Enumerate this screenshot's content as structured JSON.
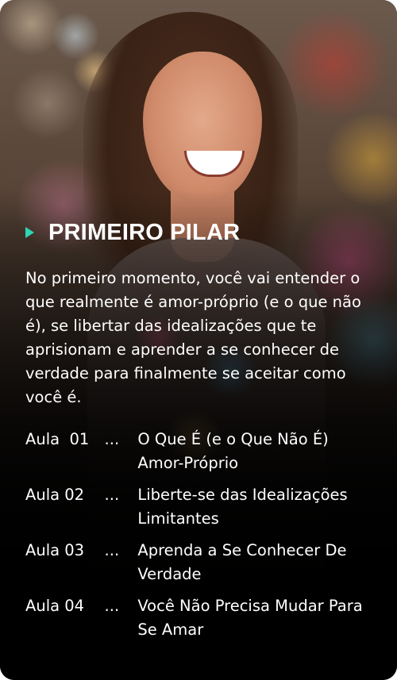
{
  "pillar": {
    "title": "PRIMEIRO PILAR",
    "description": "No primeiro momento, você vai entender o que realmente é amor-próprio (e o que não é), se libertar das idealizações que te aprisionam e aprender a se conhecer de verdade para finalmente se aceitar como você é.",
    "accent_color": "#2ed6b4",
    "icon": "play-triangle-icon"
  },
  "lessons": [
    {
      "label": "Aula  01",
      "separator": "...",
      "title": "O Que É (e o Que Não É) Amor-Próprio"
    },
    {
      "label": "Aula 02",
      "separator": "...",
      "title": "Liberte-se das Idealizações Limitantes"
    },
    {
      "label": "Aula 03",
      "separator": "...",
      "title": "Aprenda a Se Conhecer De Verdade"
    },
    {
      "label": "Aula 04",
      "separator": "...",
      "title": "Você Não Precisa Mudar Para Se Amar"
    }
  ]
}
